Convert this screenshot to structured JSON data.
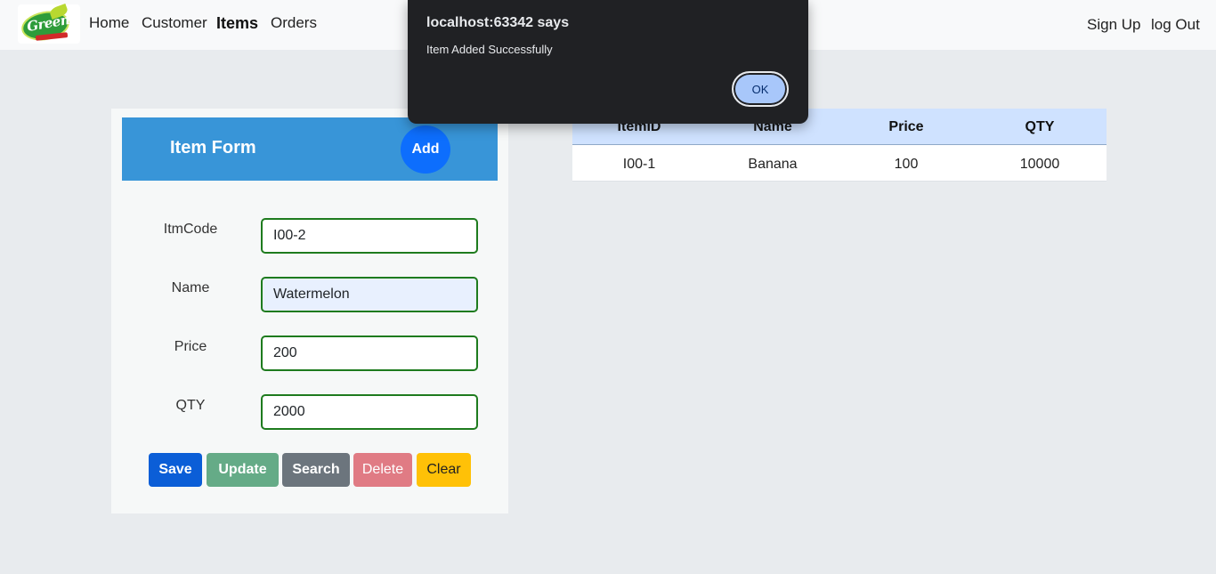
{
  "navbar": {
    "logo_text": "Green",
    "links": [
      "Home",
      "Customer",
      "Items",
      "Orders"
    ],
    "active": "Items",
    "right_links": [
      "Sign Up",
      "log Out"
    ]
  },
  "form": {
    "title": "Item Form",
    "add_label": "Add",
    "fields": [
      {
        "label": "ItmCode",
        "value": "I00-2"
      },
      {
        "label": "Name",
        "value": "Watermelon"
      },
      {
        "label": "Price",
        "value": "200"
      },
      {
        "label": "QTY",
        "value": "2000"
      }
    ],
    "buttons": {
      "save": "Save",
      "update": "Update",
      "search": "Search",
      "delete": "Delete",
      "clear": "Clear"
    }
  },
  "table": {
    "headers": [
      "ItemID",
      "Name",
      "Price",
      "QTY"
    ],
    "rows": [
      [
        "I00-1",
        "Banana",
        "100",
        "10000"
      ]
    ]
  },
  "dialog": {
    "title": "localhost:63342 says",
    "message": "Item Added Successfully",
    "ok_label": "OK"
  },
  "colors": {
    "form_header": "#3895d8",
    "table_header": "#cfe2ff",
    "input_border": "#1e7b1e",
    "dialog_bg": "#202124",
    "ok_button": "#a8c7fa"
  }
}
